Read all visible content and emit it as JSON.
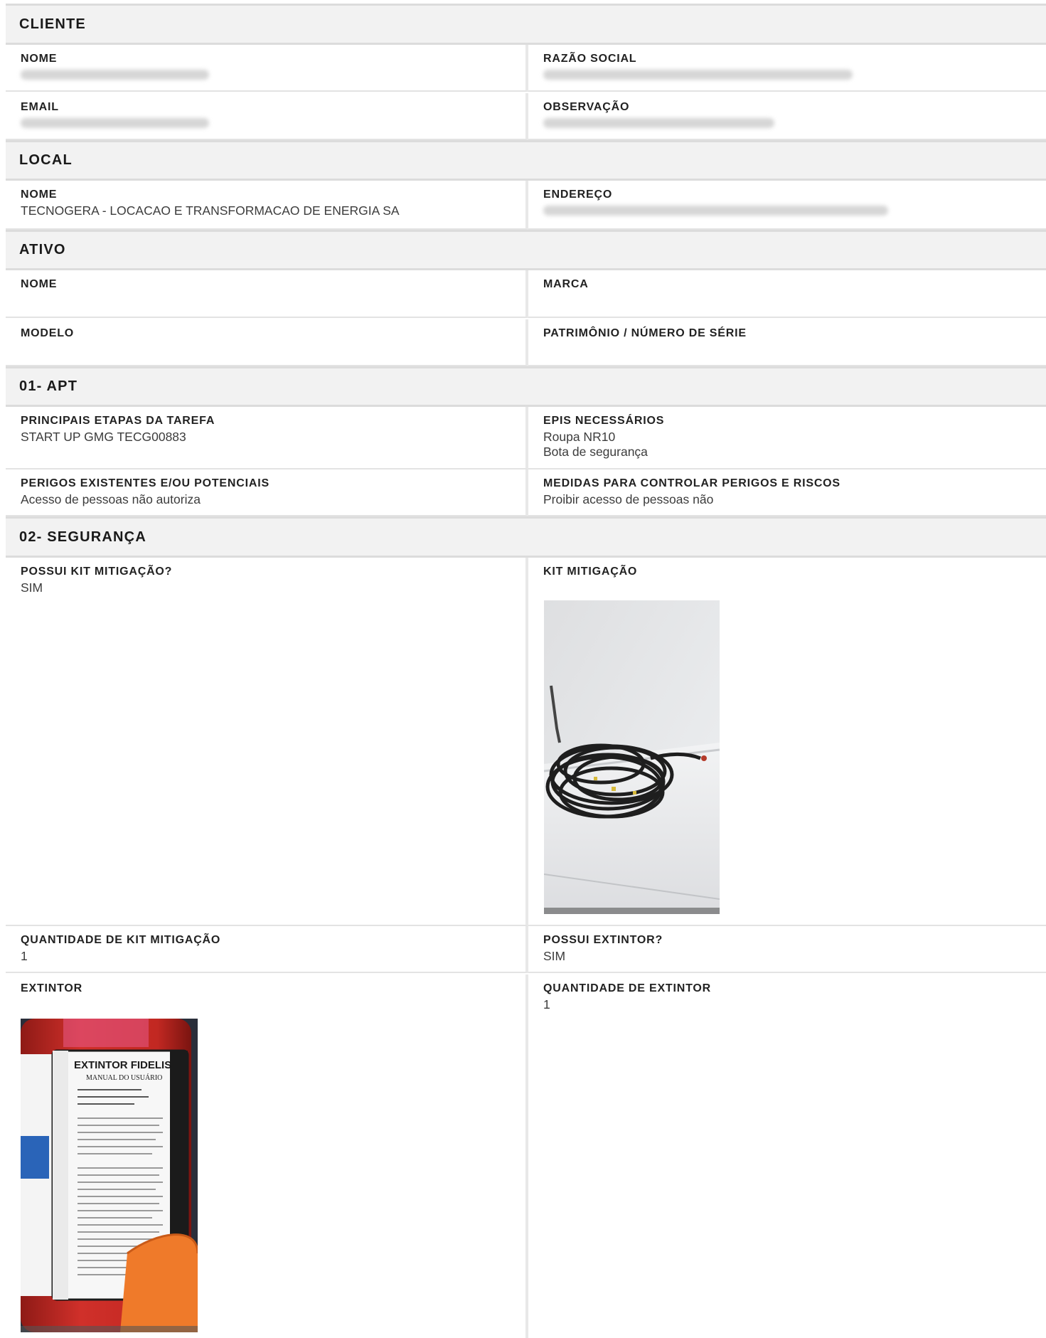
{
  "cliente": {
    "title": "CLIENTE",
    "nome_label": "NOME",
    "razao_social_label": "RAZÃO SOCIAL",
    "email_label": "EMAIL",
    "observacao_label": "OBSERVAÇÃO"
  },
  "local": {
    "title": "LOCAL",
    "nome_label": "NOME",
    "nome_value": "TECNOGERA - LOCACAO E TRANSFORMACAO DE ENERGIA SA",
    "endereco_label": "ENDEREÇO"
  },
  "ativo": {
    "title": "ATIVO",
    "nome_label": "NOME",
    "marca_label": "MARCA",
    "modelo_label": "MODELO",
    "patrimonio_label": "PATRIMÔNIO / NÚMERO DE SÉRIE"
  },
  "apt": {
    "title": "01- APT",
    "etapas_label": "PRINCIPAIS ETAPAS DA TAREFA",
    "etapas_value": "START UP GMG TECG00883",
    "epis_label": "EPIS NECESSÁRIOS",
    "epis_values": [
      "Roupa NR10",
      "Bota de segurança"
    ],
    "perigos_label": "PERIGOS EXISTENTES E/OU POTENCIAIS",
    "perigos_value": "Acesso de pessoas não autoriza",
    "medidas_label": "MEDIDAS PARA CONTROLAR PERIGOS E RISCOS",
    "medidas_value": "Proibir acesso de pessoas não"
  },
  "seguranca": {
    "title": "02- SEGURANÇA",
    "possui_kit_label": "POSSUI KIT MITIGAÇÃO?",
    "possui_kit_value": "SIM",
    "kit_label": "KIT MITIGAÇÃO",
    "qtd_kit_label": "QUANTIDADE DE KIT MITIGAÇÃO",
    "qtd_kit_value": "1",
    "possui_extintor_label": "POSSUI EXTINTOR?",
    "possui_extintor_value": "SIM",
    "extintor_label": "EXTINTOR",
    "qtd_extintor_label": "QUANTIDADE DE EXTINTOR",
    "qtd_extintor_value": "1"
  },
  "extintor_photo": {
    "title": "EXTINTOR FIDELIS",
    "subtitle": "MANUAL DO USUÁRIO"
  },
  "colors": {
    "header_bg": "#f2f2f2",
    "border": "#dcdcdc",
    "extinguisher_red": "#c8261e"
  }
}
